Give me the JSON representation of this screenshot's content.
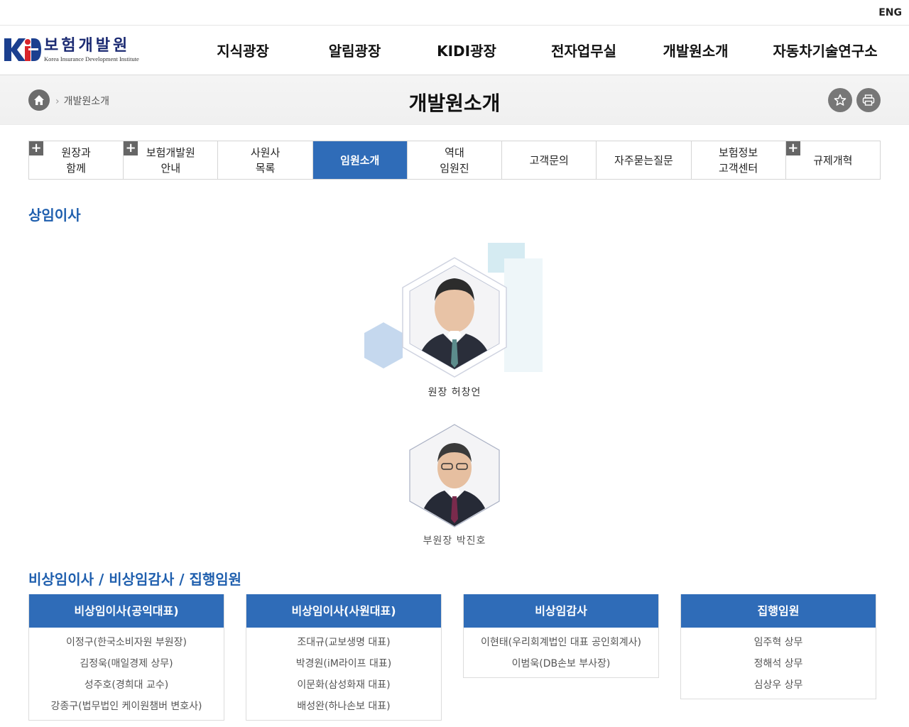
{
  "util": {
    "lang": "ENG"
  },
  "logo": {
    "korean": "보험개발원",
    "english": "Korea Insurance Development Institute"
  },
  "gnb": [
    "지식광장",
    "알림광장",
    "KIDI광장",
    "전자업무실",
    "개발원소개",
    "자동차기술연구소"
  ],
  "subbar": {
    "breadcrumb": "개발원소개",
    "title": "개발원소개"
  },
  "tabs": [
    {
      "line1": "원장과",
      "line2": "함께",
      "plus": true
    },
    {
      "line1": "보험개발원",
      "line2": "안내",
      "plus": true
    },
    {
      "line1": "사원사",
      "line2": "목록",
      "plus": false
    },
    {
      "line1": "임원소개",
      "line2": "",
      "plus": false,
      "active": true
    },
    {
      "line1": "역대",
      "line2": "임원진",
      "plus": false
    },
    {
      "line1": "고객문의",
      "line2": "",
      "plus": false
    },
    {
      "line1": "자주묻는질문",
      "line2": "",
      "plus": false
    },
    {
      "line1": "보험정보",
      "line2": "고객센터",
      "plus": false
    },
    {
      "line1": "규제개혁",
      "line2": "",
      "plus": true
    }
  ],
  "standing": {
    "title": "상임이사",
    "president": "원장 허창언",
    "vice": "부원장 박진호"
  },
  "nonstanding": {
    "title": "비상임이사 / 비상임감사 / 집행임원",
    "boxes": [
      {
        "head": "비상임이사(공익대표)",
        "items": [
          "이정구(한국소비자원 부원장)",
          "김정욱(매일경제 상무)",
          "성주호(경희대 교수)",
          "강종구(법무법인 케이원챔버 변호사)"
        ]
      },
      {
        "head": "비상임이사(사원대표)",
        "items": [
          "조대규(교보생명 대표)",
          "박경원(iM라이프 대표)",
          "이문화(삼성화재 대표)",
          "배성완(하나손보 대표)"
        ]
      },
      {
        "head": "비상임감사",
        "items": [
          "이현태(우리회계법인 대표 공인회계사)",
          "이범욱(DB손보 부사장)"
        ]
      },
      {
        "head": "집행임원",
        "items": [
          "임주혁 상무",
          "정해석 상무",
          "심상우 상무"
        ]
      }
    ]
  },
  "colors": {
    "accent": "#2f6cb8",
    "title_blue": "#1f5fae"
  }
}
